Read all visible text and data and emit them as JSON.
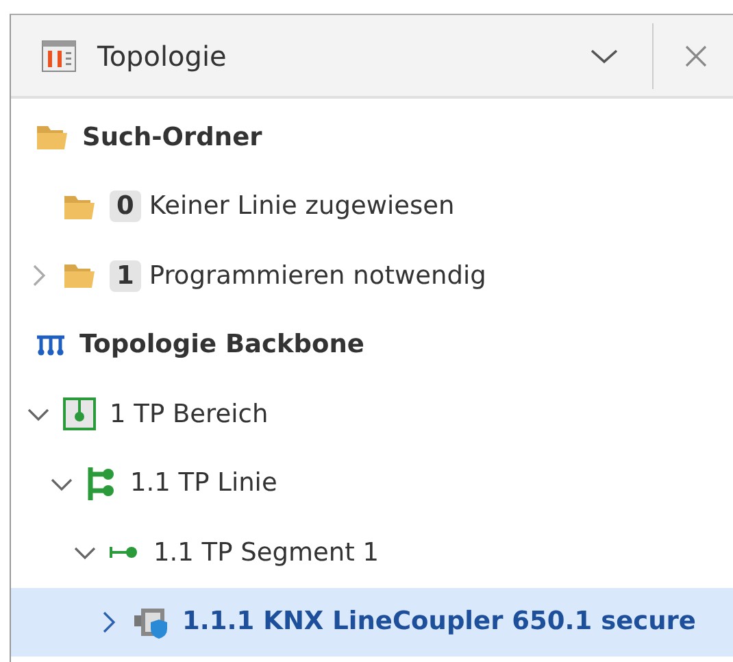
{
  "panel": {
    "title": "Topologie"
  },
  "tree": [
    {
      "kind": "folder",
      "label": "Such-Ordner",
      "selected": false,
      "children": [
        {
          "kind": "folder",
          "count": "0",
          "label": "Keiner Linie zugewiesen",
          "selected": false
        },
        {
          "kind": "folder",
          "count": "1",
          "label": "Programmieren notwendig",
          "expanded": false,
          "selected": false
        }
      ]
    },
    {
      "kind": "backbone",
      "label": "Topologie Backbone",
      "selected": false,
      "children": [
        {
          "kind": "area",
          "label": "1 TP Bereich",
          "expanded": true,
          "selected": false,
          "children": [
            {
              "kind": "line",
              "label": "1.1 TP Linie",
              "expanded": true,
              "selected": false,
              "children": [
                {
                  "kind": "segment",
                  "label": "1.1 TP Segment 1",
                  "expanded": true,
                  "selected": false,
                  "children": [
                    {
                      "kind": "device",
                      "label": "1.1.1 KNX LineCoupler 650.1 secure",
                      "expanded": false,
                      "selected": true
                    }
                  ]
                }
              ]
            }
          ]
        }
      ]
    }
  ]
}
